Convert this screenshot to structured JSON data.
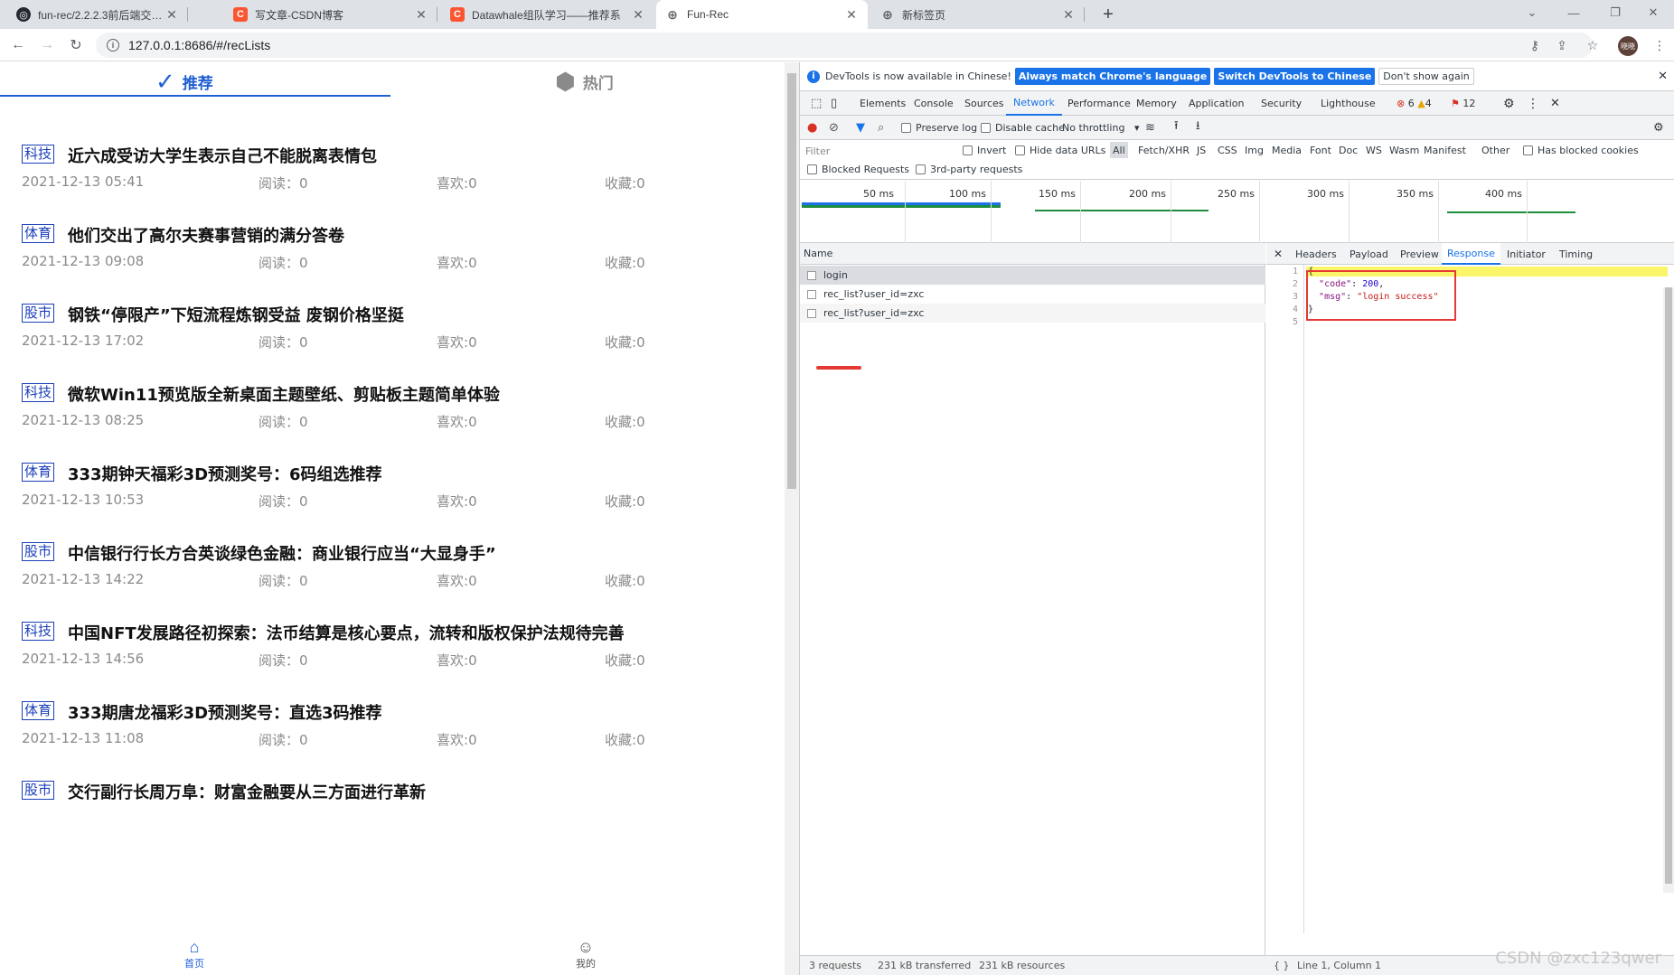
{
  "browser": {
    "tabs": [
      {
        "title": "fun-rec/2.2.2.3前后端交互.md at",
        "icon": "github-icon"
      },
      {
        "title": "写文章-CSDN博客",
        "icon": "csdn-icon"
      },
      {
        "title": "Datawhale组队学习——推荐系",
        "icon": "csdn-icon"
      },
      {
        "title": "Fun-Rec",
        "icon": "globe-icon"
      },
      {
        "title": "新标签页",
        "icon": "globe-icon"
      }
    ],
    "url": "127.0.0.1:8686/#/recLists",
    "avatar_text": "晓晓"
  },
  "app": {
    "topnav": {
      "recommend": "推荐",
      "hot": "热门"
    },
    "labels": {
      "read": "阅读：",
      "like": "喜欢:",
      "collect": "收藏:"
    },
    "news": [
      {
        "tag": "科技",
        "title": "近六成受访大学生表示自己不能脱离表情包",
        "time": "2021-12-13 05:41",
        "read": "0",
        "like": "0",
        "collect": "0"
      },
      {
        "tag": "体育",
        "title": "他们交出了高尔夫赛事营销的满分答卷",
        "time": "2021-12-13 09:08",
        "read": "0",
        "like": "0",
        "collect": "0"
      },
      {
        "tag": "股市",
        "title": "钢铁“停限产”下短流程炼钢受益 废钢价格坚挺",
        "time": "2021-12-13 17:02",
        "read": "0",
        "like": "0",
        "collect": "0"
      },
      {
        "tag": "科技",
        "title": "微软Win11预览版全新桌面主题壁纸、剪贴板主题简单体验",
        "time": "2021-12-13 08:25",
        "read": "0",
        "like": "0",
        "collect": "0"
      },
      {
        "tag": "体育",
        "title": "333期钟天福彩3D预测奖号：6码组选推荐",
        "time": "2021-12-13 10:53",
        "read": "0",
        "like": "0",
        "collect": "0"
      },
      {
        "tag": "股市",
        "title": "中信银行行长方合英谈绿色金融：商业银行应当“大显身手”",
        "time": "2021-12-13 14:22",
        "read": "0",
        "like": "0",
        "collect": "0"
      },
      {
        "tag": "科技",
        "title": "中国NFT发展路径初探索：法币结算是核心要点，流转和版权保护法规待完善",
        "time": "2021-12-13 14:56",
        "read": "0",
        "like": "0",
        "collect": "0"
      },
      {
        "tag": "体育",
        "title": "333期唐龙福彩3D预测奖号：直选3码推荐",
        "time": "2021-12-13 11:08",
        "read": "0",
        "like": "0",
        "collect": "0"
      },
      {
        "tag": "股市",
        "title": "交行副行长周万阜：财富金融要从三方面进行革新",
        "time": "",
        "read": "",
        "like": "",
        "collect": ""
      }
    ],
    "bottom_tabs": {
      "home": "首页",
      "mine": "我的"
    }
  },
  "devtools": {
    "infobar": {
      "text": "DevTools is now available in Chinese!",
      "btn1": "Always match Chrome's language",
      "btn2": "Switch DevTools to Chinese",
      "btn3": "Don't show again"
    },
    "tabs": [
      "Elements",
      "Console",
      "Sources",
      "Network",
      "Performance",
      "Memory",
      "Application",
      "Security",
      "Lighthouse"
    ],
    "badges": {
      "errors": "6",
      "warnings": "4",
      "issues": "12"
    },
    "toolbar": {
      "preserve_log": "Preserve log",
      "disable_cache": "Disable cache",
      "throttling": "No throttling"
    },
    "filter": {
      "placeholder": "Filter",
      "invert": "Invert",
      "hide_data_urls": "Hide data URLs",
      "types": [
        "All",
        "Fetch/XHR",
        "JS",
        "CSS",
        "Img",
        "Media",
        "Font",
        "Doc",
        "WS",
        "Wasm",
        "Manifest",
        "Other"
      ],
      "has_blocked_cookies": "Has blocked cookies",
      "blocked_requests": "Blocked Requests",
      "third_party": "3rd-party requests"
    },
    "timeline": [
      "50 ms",
      "100 ms",
      "150 ms",
      "200 ms",
      "250 ms",
      "300 ms",
      "350 ms",
      "400 ms"
    ],
    "reqlist_header": "Name",
    "requests": [
      "login",
      "rec_list?user_id=zxc",
      "rec_list?user_id=zxc"
    ],
    "detail_tabs": [
      "Headers",
      "Payload",
      "Preview",
      "Response",
      "Initiator",
      "Timing"
    ],
    "code": {
      "lines": [
        "1",
        "2",
        "3",
        "4",
        "5"
      ],
      "open": "{",
      "k1": "\"code\"",
      "v1": "200",
      "k2": "\"msg\"",
      "v2": "\"login success\"",
      "close": "}"
    },
    "status": {
      "requests": "3 requests",
      "transferred": "231 kB transferred",
      "resources": "231 kB resources",
      "cursor": "Line 1, Column 1"
    }
  },
  "watermark": "CSDN @zxc123qwer"
}
